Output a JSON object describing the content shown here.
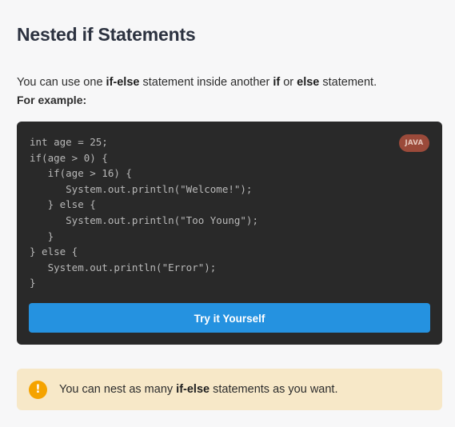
{
  "lesson": {
    "title": "Nested if Statements",
    "intro": {
      "part1": "You can use one ",
      "kw1": "if-else",
      "part2": " statement inside another ",
      "kw2": "if",
      "part3": " or ",
      "kw3": "else",
      "part4": " statement."
    },
    "example_label": "For example:"
  },
  "code_block": {
    "language_badge": "JAVA",
    "code": "int age = 25;\nif(age > 0) {\n   if(age > 16) {\n      System.out.println(\"Welcome!\");\n   } else {\n      System.out.println(\"Too Young\");\n   }\n} else {\n   System.out.println(\"Error\");\n}",
    "try_button_label": "Try it Yourself"
  },
  "note": {
    "icon": "exclamation-icon",
    "icon_glyph": "!",
    "part1": "You can nest as many ",
    "kw": "if-else",
    "part2": " statements as you want."
  },
  "colors": {
    "background": "#f7f7f8",
    "code_background": "#292929",
    "button": "#2592e0",
    "badge": "#9b4a3a",
    "note_background": "#f7e8c8",
    "note_icon": "#f5a300"
  }
}
